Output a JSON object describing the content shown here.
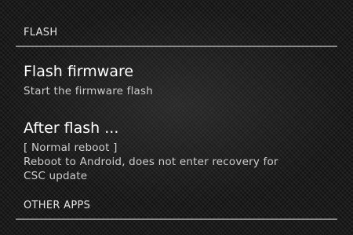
{
  "sections": {
    "flash_header": "FLASH",
    "other_apps_header": "OTHER APPS"
  },
  "flash_firmware": {
    "title": "Flash firmware",
    "summary": "Start the firmware flash"
  },
  "after_flash": {
    "title": "After flash ...",
    "value": "[ Normal reboot ]",
    "summary_line1": "Reboot to Android, does not enter recovery for",
    "summary_line2": "CSC update"
  }
}
